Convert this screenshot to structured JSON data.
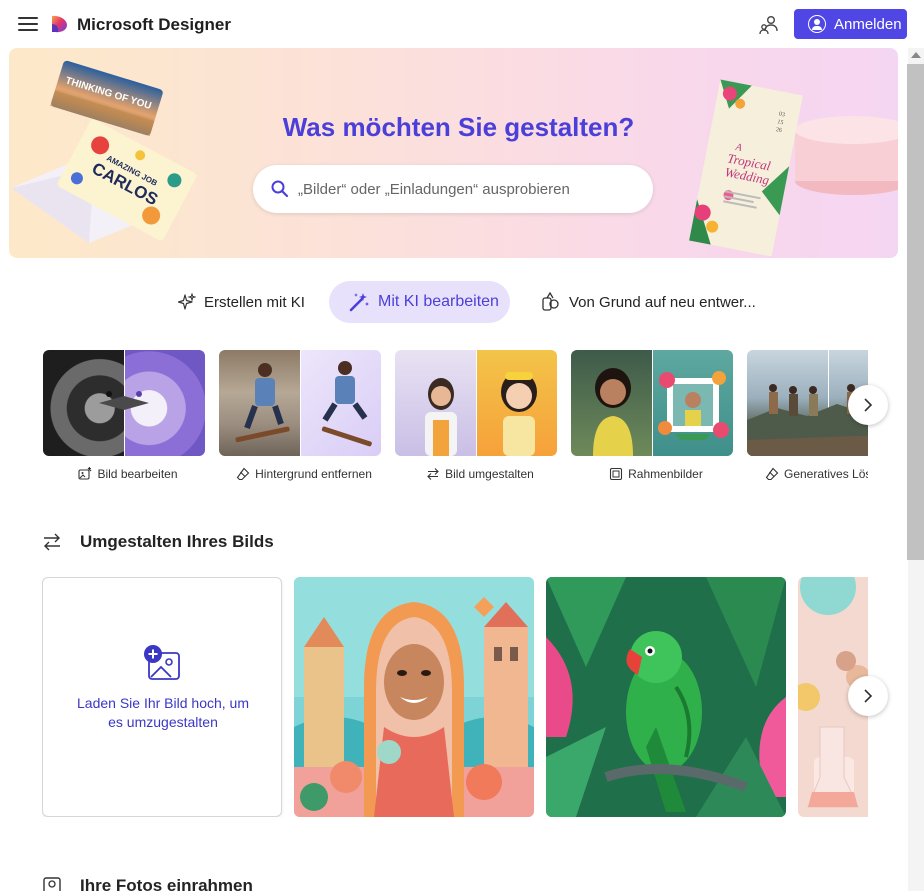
{
  "header": {
    "app_title": "Microsoft Designer",
    "signin_label": "Anmelden",
    "accent": "#4f46e5"
  },
  "hero": {
    "title": "Was möchten Sie gestalten?",
    "search_placeholder": "„Bilder“ oder „Einladungen“ ausprobieren",
    "card1_text": "THINKING OF YOU",
    "card2_text_top": "AMAZING JOB",
    "card2_text_name": "CARLOS",
    "invite_title_1": "A",
    "invite_title_2": "Tropical",
    "invite_title_3": "Wedding",
    "invite_date_1": "03",
    "invite_date_2": "15",
    "invite_date_3": "26"
  },
  "tabs": [
    {
      "label": "Erstellen mit KI",
      "icon": "sparkle-icon"
    },
    {
      "label": "Mit KI bearbeiten",
      "icon": "magic-wand-icon",
      "active": true
    },
    {
      "label": "Von Grund auf neu entwer...",
      "icon": "shapes-icon"
    }
  ],
  "tools": [
    {
      "label": "Bild bearbeiten",
      "icon": "image-edit-icon"
    },
    {
      "label": "Hintergrund entfernen",
      "icon": "eraser-icon"
    },
    {
      "label": "Bild umgestalten",
      "icon": "arrows-swap-icon"
    },
    {
      "label": "Rahmenbilder",
      "icon": "frame-icon"
    },
    {
      "label": "Generatives Lösc",
      "icon": "eraser-icon"
    }
  ],
  "section_restyle": {
    "title": "Umgestalten Ihres Bilds",
    "upload_text": "Laden Sie Ihr Bild hoch, um es umzugestalten"
  },
  "section_frame": {
    "title": "Ihre Fotos einrahmen"
  }
}
